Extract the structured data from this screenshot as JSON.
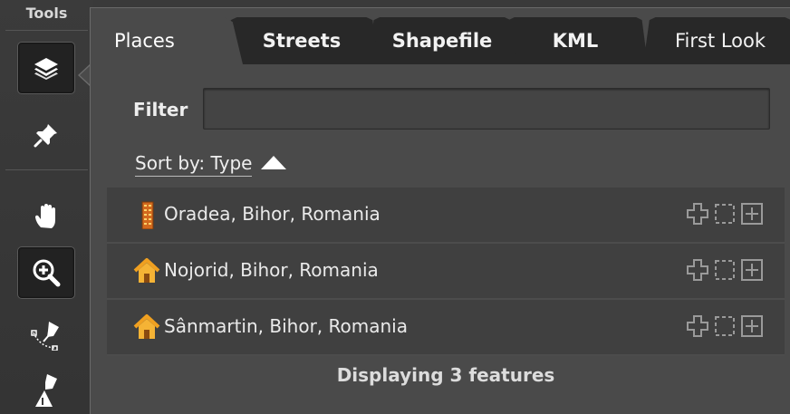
{
  "tools": {
    "title": "Tools",
    "items": [
      {
        "icon": "layers-icon",
        "active": true
      },
      {
        "icon": "pushpin-icon",
        "active": false
      },
      {
        "icon": "pan-hand-icon",
        "active": false
      },
      {
        "icon": "zoom-in-icon",
        "active": true
      },
      {
        "icon": "path-pen-icon",
        "active": false
      },
      {
        "icon": "polygon-pen-icon",
        "active": false
      }
    ]
  },
  "tabs": [
    {
      "label": "Places",
      "active": true
    },
    {
      "label": "Streets",
      "active": false
    },
    {
      "label": "Shapefile",
      "active": false
    },
    {
      "label": "KML",
      "active": false
    },
    {
      "label": "First Look",
      "active": false
    }
  ],
  "filter": {
    "label": "Filter",
    "value": "",
    "placeholder": ""
  },
  "sort": {
    "label": "Sort by: Type",
    "direction": "ascending"
  },
  "places": [
    {
      "icon": "city-building-icon",
      "label": "Oradea, Bihor, Romania"
    },
    {
      "icon": "house-icon",
      "label": "Nojorid, Bihor, Romania"
    },
    {
      "icon": "house-icon",
      "label": "Sânmartin, Bihor, Romania"
    }
  ],
  "row_actions": [
    "add-cross-icon",
    "select-dashed-icon",
    "add-box-icon"
  ],
  "footer": "Displaying 3 features",
  "colors": {
    "panel": "#4a4a4a",
    "tab_inactive": "#282828",
    "row": "#404040",
    "house": "#f0a020",
    "building": "#d2691e"
  }
}
